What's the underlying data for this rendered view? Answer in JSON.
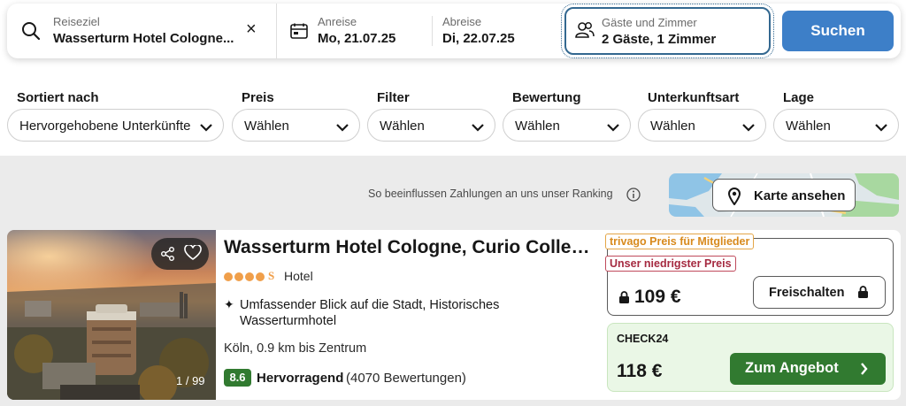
{
  "search": {
    "destination_label": "Reiseziel",
    "destination_value": "Wasserturm Hotel Cologne...",
    "clear_icon": "×",
    "arrival_label": "Anreise",
    "arrival_value": "Mo, 21.07.25",
    "departure_label": "Abreise",
    "departure_value": "Di, 22.07.25",
    "guests_label": "Gäste und Zimmer",
    "guests_value": "2 Gäste, 1 Zimmer",
    "search_button": "Suchen",
    "colors": {
      "accent": "#3d7fc8",
      "focus_border": "#336890"
    }
  },
  "filters": [
    {
      "title": "Sortiert nach",
      "value": "Hervorgehobene Unterkünfte"
    },
    {
      "title": "Preis",
      "value": "Wählen"
    },
    {
      "title": "Filter",
      "value": "Wählen"
    },
    {
      "title": "Bewertung",
      "value": "Wählen"
    },
    {
      "title": "Unterkunftsart",
      "value": "Wählen"
    },
    {
      "title": "Lage",
      "value": "Wählen"
    }
  ],
  "ranking_note": "So beeinflussen Zahlungen an uns unser Ranking",
  "map_button": "Karte ansehen",
  "hotel": {
    "name": "Wasserturm Hotel Cologne, Curio Collecti...",
    "stars": 4,
    "stars_suffix": "S",
    "type": "Hotel",
    "highlight": "Umfassender Blick auf die Stadt, Historisches Wasserturmhotel",
    "location": "Köln, 0.9 km bis Zentrum",
    "rating_score": "8.6",
    "rating_label": "Hervorragend",
    "rating_count": "(4070 Bewertungen)",
    "photo_counter": "1 / 99",
    "icons": [
      "share-icon",
      "heart-icon",
      "sparkle-icon"
    ]
  },
  "offers": {
    "member_tag": "trivago Preis für Mitglieder",
    "lowest_tag": "Unser niedrigster Preis",
    "member_price": "109 €",
    "unlock_button": "Freischalten",
    "provider": "CHECK24",
    "provider_price": "118 €",
    "deal_button": "Zum Angebot",
    "colors": {
      "deal_green": "#317a30",
      "member_orange": "#d88a1d",
      "lowest_red": "#a52a40",
      "offer_bg": "#eaf7e6"
    }
  }
}
